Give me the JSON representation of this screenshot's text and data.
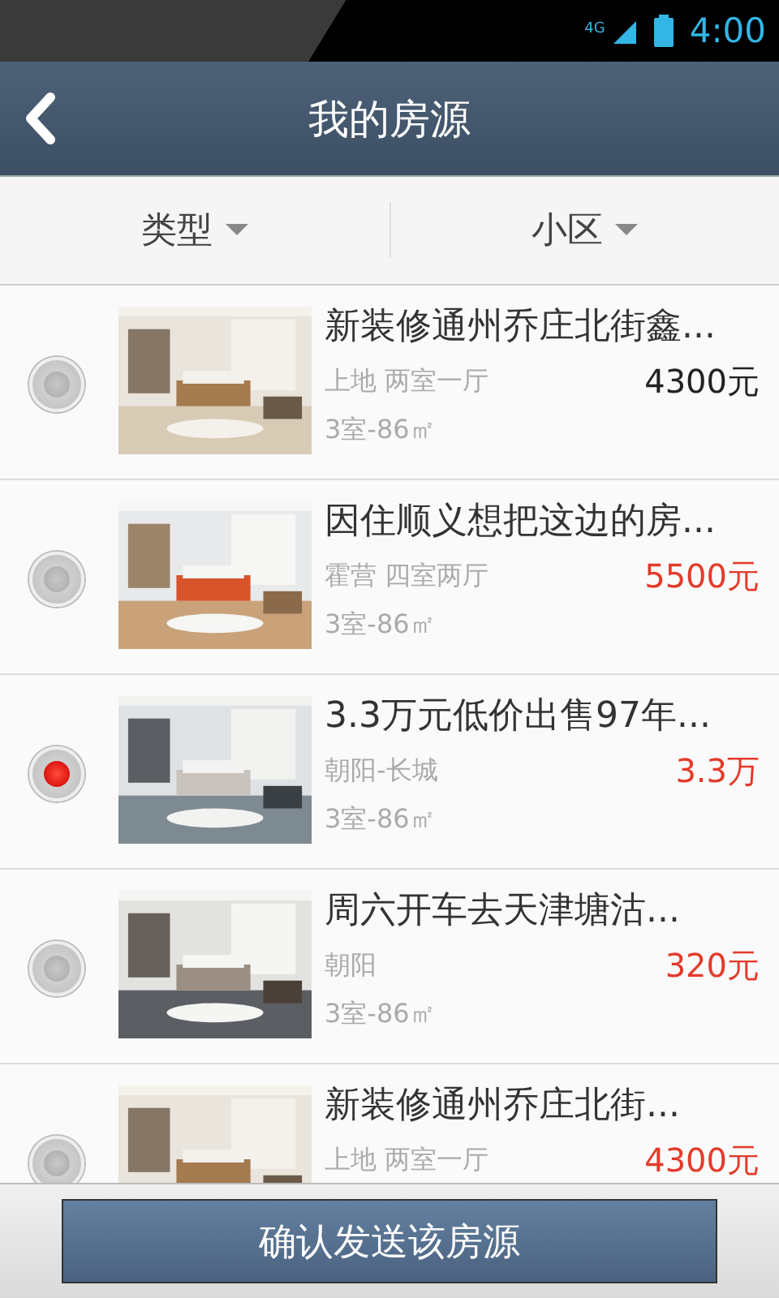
{
  "status_bar": {
    "network": "4G",
    "time": "4:00"
  },
  "header": {
    "title": "我的房源"
  },
  "filters": [
    {
      "label": "类型"
    },
    {
      "label": "小区"
    }
  ],
  "listings": [
    {
      "title": "新装修通州乔庄北街鑫...",
      "location": "上地 两室一厅",
      "price": "4300元",
      "price_highlighted": false,
      "detail": "3室-86㎡",
      "selected": false
    },
    {
      "title": "因住顺义想把这边的房...",
      "location": "霍营 四室两厅",
      "price": "5500元",
      "price_highlighted": true,
      "detail": "3室-86㎡",
      "selected": false
    },
    {
      "title": "3.3万元低价出售97年...",
      "location": "朝阳-长城",
      "price": "3.3万",
      "price_highlighted": true,
      "detail": "3室-86㎡",
      "selected": true
    },
    {
      "title": "周六开车去天津塘沽...",
      "location": "朝阳",
      "price": "320元",
      "price_highlighted": true,
      "detail": "3室-86㎡",
      "selected": false
    },
    {
      "title": "新装修通州乔庄北街...",
      "location": "上地 两室一厅",
      "price": "4300元",
      "price_highlighted": true,
      "selected": false
    }
  ],
  "confirm_button": "确认发送该房源"
}
